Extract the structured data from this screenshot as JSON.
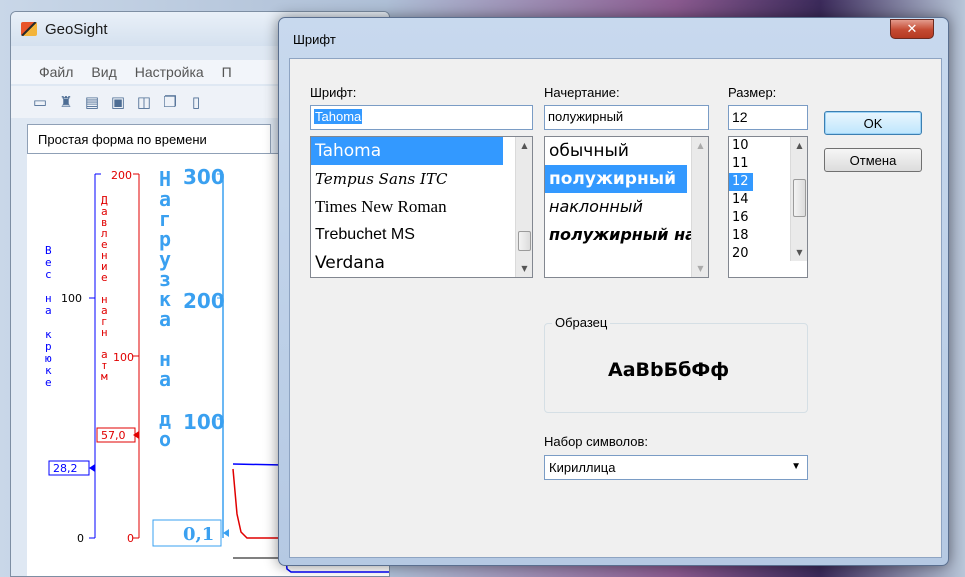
{
  "app": {
    "title": "GeoSight",
    "menu": [
      "Файл",
      "Вид",
      "Настройка",
      "П"
    ],
    "tab": "Простая форма по времени",
    "axes": {
      "weight": {
        "label": "Вес на крюке",
        "ticks": [
          "100",
          "0"
        ],
        "value": "28,2"
      },
      "pressure": {
        "label": "Давление нагн атм",
        "ticks": [
          "200",
          "100",
          "0"
        ],
        "value": "57,0"
      },
      "load": {
        "label": "Нагрузка на до",
        "ticks": [
          "300",
          "200",
          "100"
        ],
        "value": "0,1"
      }
    },
    "colors": {
      "weight": "#0000ff",
      "pressure": "#e00000",
      "load": "#3aa0f0"
    }
  },
  "dialog": {
    "title": "Шрифт",
    "close_icon": "close-icon",
    "font_label": "Шрифт:",
    "font_value": "Tahoma",
    "font_list": [
      "Tahoma",
      "Tempus Sans ITC",
      "Times New Roman",
      "Trebuchet MS",
      "Verdana"
    ],
    "style_label": "Начертание:",
    "style_value": "полужирный",
    "style_list": [
      "обычный",
      "полужирный",
      "наклонный",
      "полужирный наклонный"
    ],
    "size_label": "Размер:",
    "size_value": "12",
    "size_list": [
      "10",
      "11",
      "12",
      "14",
      "16",
      "18",
      "20"
    ],
    "ok": "OK",
    "cancel": "Отмена",
    "sample_label": "Образец",
    "sample_text": "AaBbБбФф",
    "charset_label": "Набор символов:",
    "charset_value": "Кириллица"
  }
}
